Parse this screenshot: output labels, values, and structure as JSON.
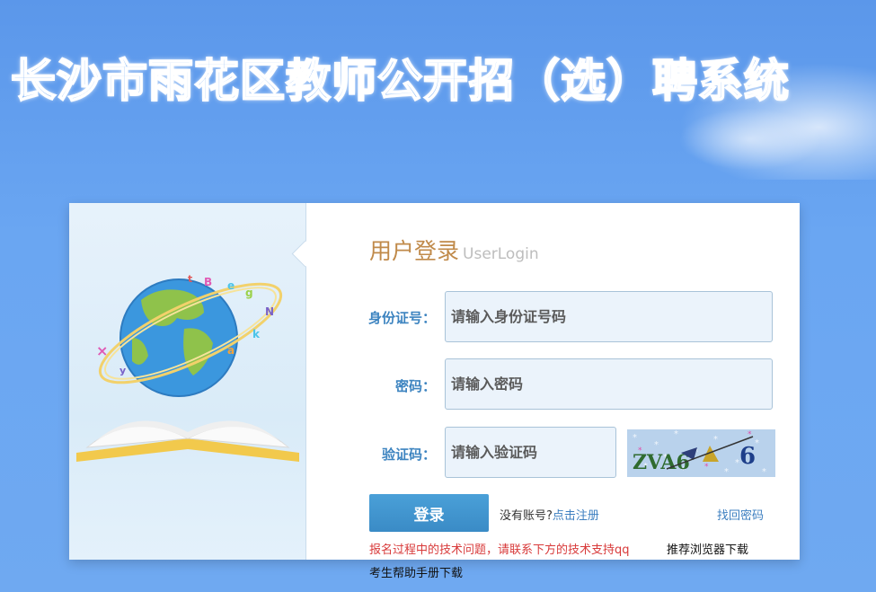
{
  "site": {
    "title": "长沙市雨花区教师公开招（选）聘系统"
  },
  "login": {
    "title_zh": "用户登录",
    "title_en": "UserLogin",
    "id_label": "身份证号：",
    "id_placeholder": "请输入身份证号码",
    "password_label": "密码：",
    "password_placeholder": "请输入密码",
    "captcha_label": "验证码：",
    "captcha_placeholder": "请输入验证码",
    "captcha_text": "ZVA6",
    "submit_label": "登录",
    "no_account_text": "没有账号?",
    "register_link": "点击注册",
    "forgot_link": "找回密码",
    "notice": "报名过程中的技术问题，请联系下方的技术支持qq",
    "browser_download": "推荐浏览器下载",
    "manual_download": "考生帮助手册下载"
  },
  "colors": {
    "background": "#6aa6f2",
    "accent_blue": "#3d84c0",
    "heading_gold": "#c08a4a",
    "notice_red": "#d83a3a"
  },
  "icons": [
    "globe-book-illustration"
  ]
}
